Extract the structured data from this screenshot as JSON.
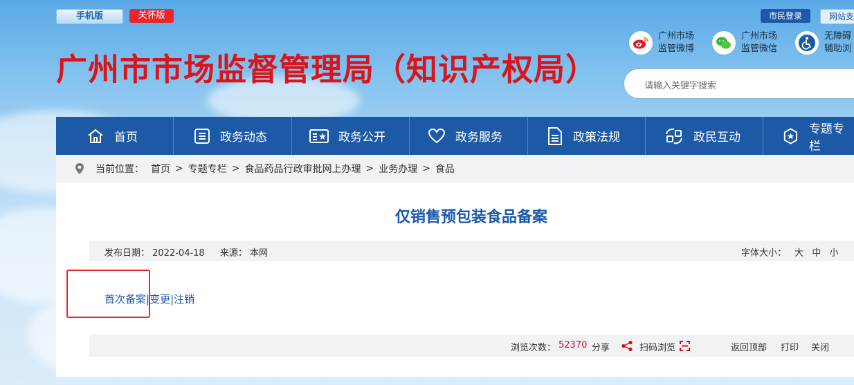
{
  "header": {
    "mobile_label": "手机版",
    "care_label": "关怀版",
    "login_label": "市民登录",
    "support_label": "网站支",
    "site_title": "广州市市场监督管理局（知识产权局）",
    "social": [
      {
        "line1": "广州市场",
        "line2": "监管微博",
        "icon": "weibo-icon"
      },
      {
        "line1": "广州市场",
        "line2": "监管微信",
        "icon": "wechat-icon"
      },
      {
        "line1": "无障碍",
        "line2": "辅助浏",
        "icon": "accessibility-icon"
      }
    ],
    "search_placeholder": "请输入关键字搜索"
  },
  "nav": {
    "items": [
      {
        "label": "首页",
        "icon": "home-icon"
      },
      {
        "label": "政务动态",
        "icon": "news-icon"
      },
      {
        "label": "政务公开",
        "icon": "public-icon"
      },
      {
        "label": "政务服务",
        "icon": "heart-icon"
      },
      {
        "label": "政策法规",
        "icon": "document-icon"
      },
      {
        "label": "政民互动",
        "icon": "interaction-icon"
      },
      {
        "label": "专题专栏",
        "icon": "badge-icon"
      }
    ]
  },
  "breadcrumb": {
    "prefix": "当前位置：",
    "items": [
      "首页",
      "专题专栏",
      "食品药品行政审批网上办理",
      "业务办理",
      "食品"
    ],
    "separator": ">"
  },
  "article": {
    "title": "仅销售预包装食品备案",
    "date_label": "发布日期：",
    "date": "2022-04-18",
    "source_label": "来源：",
    "source": "本网",
    "font_size_label": "字体大小：",
    "font_sizes": [
      "大",
      "中",
      "小"
    ],
    "links": [
      "首次备案",
      "变更",
      "注销"
    ],
    "link_separator": "|"
  },
  "footer": {
    "views_label": "浏览次数：",
    "views": "52370",
    "share_label": "分享",
    "scan_label": "扫码浏览",
    "back_top": "返回顶部",
    "print": "打印",
    "close": "关闭"
  },
  "colors": {
    "nav_bg": "#1c5aa8",
    "title_red": "#d9141b",
    "highlight_red": "#e32a2a",
    "views_red": "#c8141a"
  }
}
